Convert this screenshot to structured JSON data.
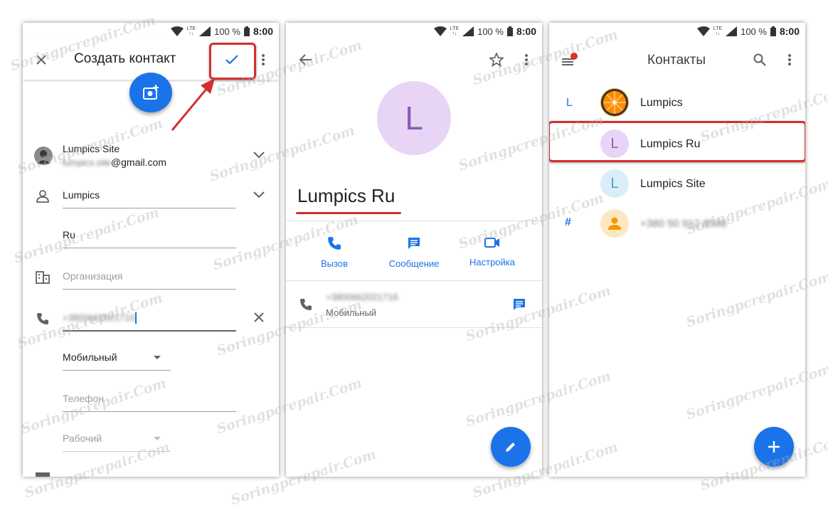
{
  "status": {
    "lte": "LTE",
    "battery": "100 %",
    "time": "8:00"
  },
  "create": {
    "title": "Создать контакт",
    "account_name": "Lumpics Site",
    "account_email_hidden": "lumpics.site",
    "account_email_domain": "@gmail.com",
    "first_name": "Lumpics",
    "last_name": "Ru",
    "org_placeholder": "Организация",
    "phone_hidden": "+380066202171б",
    "phone_type": "Мобильный",
    "phone2_placeholder": "Телефон",
    "phone2_type": "Рабочий"
  },
  "detail": {
    "avatar_letter": "L",
    "name": "Lumpics Ru",
    "actions": [
      {
        "label": "Вызов"
      },
      {
        "label": "Сообщение"
      },
      {
        "label": "Настройка"
      }
    ],
    "phone_hidden": "+380066202171б",
    "phone_type": "Мобильный"
  },
  "contacts": {
    "title": "Контакты",
    "sections": [
      {
        "letter": "L"
      },
      {
        "letter": "#"
      }
    ],
    "items": [
      {
        "avatar": "",
        "name": "Lumpics"
      },
      {
        "avatar": "L",
        "name": "Lumpics Ru"
      },
      {
        "avatar": "L",
        "name": "Lumpics Site"
      },
      {
        "avatar": "",
        "name": "+380 50 912 8598"
      }
    ]
  },
  "watermark": "Soringpcrepair.Com",
  "colors": {
    "accent": "#1a73e8",
    "highlight": "#d32f2f",
    "avatar_purple": "#e8d5f5",
    "avatar_blue": "#d9eef8",
    "avatar_orange": "#fde7c3"
  }
}
